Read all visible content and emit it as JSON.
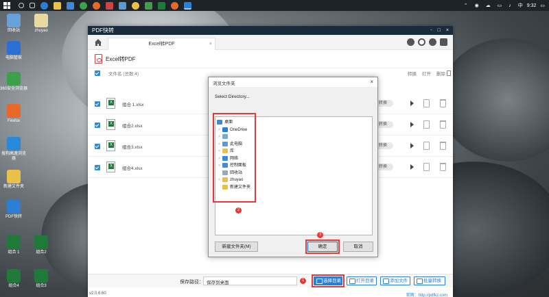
{
  "taskbar": {
    "time": "9:32"
  },
  "desktop_icons": [
    {
      "label": "回收站",
      "color": "#6aa0d8"
    },
    {
      "label": "zhuyao",
      "color": "#e8d9a0"
    },
    {
      "label": "电脑管家",
      "color": "#2a6fd6"
    },
    {
      "label": "360安全浏览器",
      "color": "#3ca14a"
    },
    {
      "label": "Firefox",
      "color": "#e8682a"
    },
    {
      "label": "搜狗高速浏览器",
      "color": "#2b8ad8"
    },
    {
      "label": "新建文件夹",
      "color": "#e8c04a"
    },
    {
      "label": "PDF快转",
      "color": "#2b7fd4"
    },
    {
      "label": "组合 1",
      "color": "#1f7a3a"
    },
    {
      "label": "组合2",
      "color": "#1f7a3a"
    },
    {
      "label": "组合4",
      "color": "#1f7a3a"
    },
    {
      "label": "组合3",
      "color": "#1f7a3a"
    }
  ],
  "app": {
    "title": "PDF快转",
    "window_controls": [
      "-",
      "□",
      "×"
    ],
    "tab": "Excel转PDF",
    "section_title": "Excel转PDF",
    "columns": {
      "file": "文件名 (总数:4)",
      "convert": "转换",
      "open": "打开",
      "delete": "删除"
    },
    "files": [
      {
        "name": "组合 1.xlsx",
        "status": "转换"
      },
      {
        "name": "组合2.xlsx",
        "status": "转换"
      },
      {
        "name": "组合3.xlsx",
        "status": "转换"
      },
      {
        "name": "组合4.xlsx",
        "status": "转换"
      }
    ],
    "save_label": "保存路径：",
    "save_value": "保存到桌面",
    "buttons": {
      "choose_dir": "选择目录",
      "open_dir": "打开目录",
      "add_file": "添加文件",
      "batch": "批量转换"
    },
    "version": "v2.0.6.60",
    "website": "官网：http://pdfkz.com"
  },
  "dialog": {
    "title": "浏览文件夹",
    "description": "Select Directory...",
    "tree": [
      {
        "label": "桌面",
        "level": 0,
        "icon": "#3a8ad8",
        "arrow": ""
      },
      {
        "label": "OneDrive",
        "level": 1,
        "icon": "#2b7fd4",
        "arrow": ">"
      },
      {
        "label": "",
        "level": 1,
        "icon": "#7aa9d0",
        "arrow": ">"
      },
      {
        "label": "此电脑",
        "level": 1,
        "icon": "#5a9bd5",
        "arrow": ">"
      },
      {
        "label": "库",
        "level": 1,
        "icon": "#e8c04a",
        "arrow": ">"
      },
      {
        "label": "网络",
        "level": 1,
        "icon": "#3a8ad8",
        "arrow": ">"
      },
      {
        "label": "控制面板",
        "level": 1,
        "icon": "#4a8ac8",
        "arrow": ">"
      },
      {
        "label": "回收站",
        "level": 1,
        "icon": "#9ab",
        "arrow": ""
      },
      {
        "label": "zhuyao",
        "level": 1,
        "icon": "#e8c04a",
        "arrow": ">"
      },
      {
        "label": "新建文件夹",
        "level": 1,
        "icon": "#e8c04a",
        "arrow": ""
      }
    ],
    "new_folder": "新建文件夹(M)",
    "ok": "确定",
    "cancel": "取消"
  },
  "badges": [
    "1",
    "2",
    "3"
  ],
  "colors": {
    "accent": "#2b7fd4",
    "highlight": "#e53935",
    "titlebar": "#1a2b3c"
  }
}
